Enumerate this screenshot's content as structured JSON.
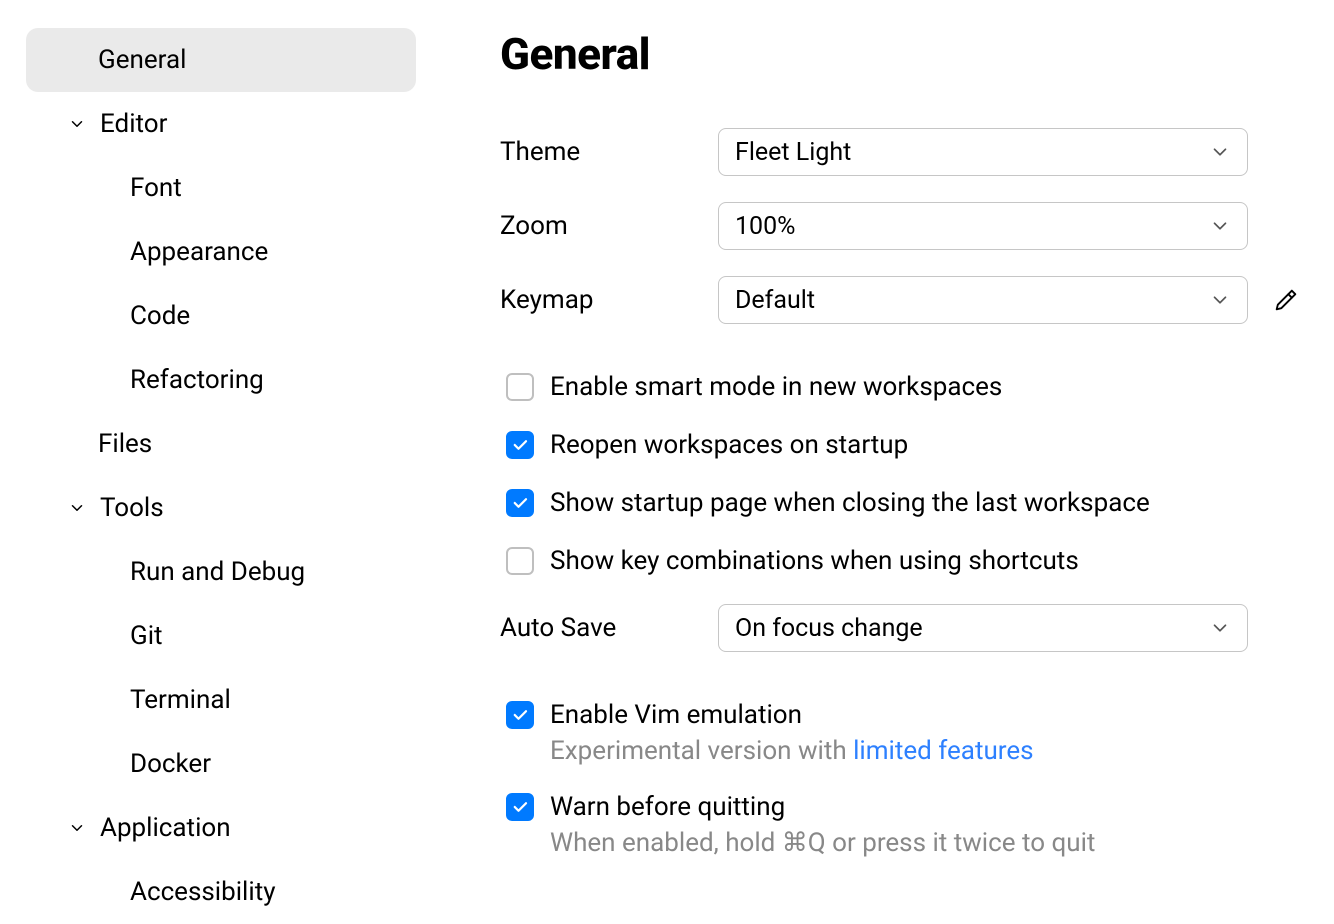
{
  "sidebar": {
    "items": [
      {
        "label": "General",
        "selected": true
      },
      {
        "label": "Editor",
        "expandable": true
      },
      {
        "label": "Font",
        "child": 1
      },
      {
        "label": "Appearance",
        "child": 1
      },
      {
        "label": "Code",
        "child": 1
      },
      {
        "label": "Refactoring",
        "child": 1
      },
      {
        "label": "Files",
        "child": 2
      },
      {
        "label": "Tools",
        "expandable": true
      },
      {
        "label": "Run and Debug",
        "child": 1
      },
      {
        "label": "Git",
        "child": 1
      },
      {
        "label": "Terminal",
        "child": 1
      },
      {
        "label": "Docker",
        "child": 1
      },
      {
        "label": "Application",
        "expandable": true
      },
      {
        "label": "Accessibility",
        "child": 1
      }
    ]
  },
  "main": {
    "title": "General",
    "theme": {
      "label": "Theme",
      "value": "Fleet Light"
    },
    "zoom": {
      "label": "Zoom",
      "value": "100%"
    },
    "keymap": {
      "label": "Keymap",
      "value": "Default"
    },
    "smart_mode": {
      "label": "Enable smart mode in new workspaces",
      "checked": false
    },
    "reopen": {
      "label": "Reopen workspaces on startup",
      "checked": true
    },
    "show_startup": {
      "label": "Show startup page when closing the last workspace",
      "checked": true
    },
    "show_keycombos": {
      "label": "Show key combinations when using shortcuts",
      "checked": false
    },
    "autosave": {
      "label": "Auto Save",
      "value": "On focus change"
    },
    "vim": {
      "label": "Enable Vim emulation",
      "checked": true,
      "desc_prefix": "Experimental version with ",
      "desc_link": "limited features"
    },
    "warn_quit": {
      "label": "Warn before quitting",
      "checked": true,
      "desc": "When enabled, hold ⌘Q or press it twice to quit"
    }
  }
}
